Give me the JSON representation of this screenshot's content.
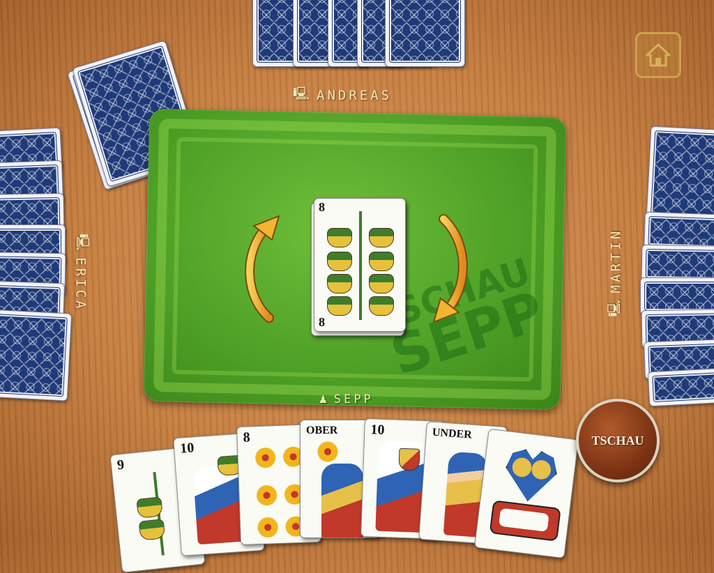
{
  "players": {
    "top": {
      "name": "ANDREAS",
      "icon": "robot-icon"
    },
    "left": {
      "name": "ERICA",
      "icon": "robot-icon"
    },
    "right": {
      "name": "MARTIN",
      "icon": "robot-icon"
    },
    "bottom": {
      "name": "SEPP",
      "icon": "person-icon"
    }
  },
  "table": {
    "watermark_line1": "TSCHAU",
    "watermark_line2": "SEPP",
    "discard_card": {
      "rank": "8",
      "suit": "acorns"
    },
    "direction": "clockwise"
  },
  "hand": [
    {
      "rank": "9",
      "suit": "acorns"
    },
    {
      "rank": "10",
      "suit": "acorns"
    },
    {
      "rank": "8",
      "suit": "flowers"
    },
    {
      "rank": "OBER",
      "suit": "flowers"
    },
    {
      "rank": "10",
      "suit": "shields"
    },
    {
      "rank": "UNDER",
      "suit": "shields"
    },
    {
      "rank": "",
      "suit": "hearts"
    }
  ],
  "buttons": {
    "tschau": "TSCHAU",
    "home": "home-icon"
  },
  "colors": {
    "felt": "#4c9e25",
    "card_back": "#1f3a78",
    "label": "#f4e9b0",
    "tschau_button": "#7d3414"
  }
}
